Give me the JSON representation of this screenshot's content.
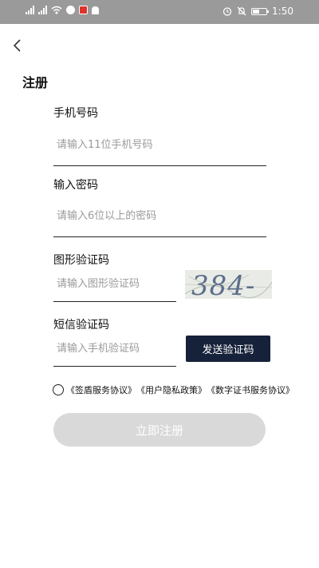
{
  "status_bar": {
    "time": "1:50",
    "left_icons": [
      "signal-icon",
      "signal-icon",
      "wifi-icon",
      "app-notification-icon",
      "app-notification-icon",
      "bell-icon"
    ],
    "right_icons": [
      "alarm-icon",
      "mute-icon",
      "battery-icon"
    ]
  },
  "header": {
    "back_icon": "back-arrow-icon",
    "title": "注册"
  },
  "form": {
    "phone": {
      "label": "手机号码",
      "placeholder": "请输入11位手机号码",
      "value": ""
    },
    "password": {
      "label": "输入密码",
      "placeholder": "请输入6位以上的密码",
      "value": ""
    },
    "captcha": {
      "label": "图形验证码",
      "placeholder": "请输入图形验证码",
      "value": "",
      "image_text": "384-"
    },
    "sms": {
      "label": "短信验证码",
      "placeholder": "请输入手机验证码",
      "value": "",
      "send_label": "发送验证码"
    }
  },
  "agreement": {
    "checked": false,
    "links": [
      "《签盾服务协议》",
      "《用户隐私政策》",
      "《数字证书服务协议》"
    ]
  },
  "register_label": "立即注册",
  "colors": {
    "send_button": "#16213a",
    "register_disabled": "#d9d9d9",
    "status_bar": "#9a9a9a"
  }
}
